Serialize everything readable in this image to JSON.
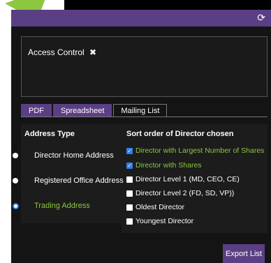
{
  "filter": {
    "chip_label": "Access Control",
    "chip_remove": "✖"
  },
  "tabs": [
    {
      "label": "PDF",
      "active": false
    },
    {
      "label": "Spreadsheet",
      "active": false
    },
    {
      "label": "Mailing List",
      "active": true
    }
  ],
  "address_type": {
    "header": "Address Type",
    "options": [
      {
        "label": "Director Home Address",
        "selected": false
      },
      {
        "label": "Registered Office Address",
        "selected": false
      },
      {
        "label": "Trading Address",
        "selected": true
      }
    ]
  },
  "sort_order": {
    "header": "Sort order of Director chosen",
    "options": [
      {
        "label": "Director with Largest Number of Shares",
        "checked": true
      },
      {
        "label": "Director with Shares",
        "checked": true
      },
      {
        "label": "Director Level 1 (MD, CEO, CE)",
        "checked": false
      },
      {
        "label": "Director Level 2 (FD, SD, VP))",
        "checked": false
      },
      {
        "label": "Oldest Director",
        "checked": false
      },
      {
        "label": "Youngest Director",
        "checked": false
      }
    ]
  },
  "actions": {
    "export_label": "Export List"
  },
  "icons": {
    "refresh": "refresh-icon",
    "checkmark": "✓"
  },
  "colors": {
    "accent_purple": "#5b3f84",
    "active_green": "#8dc63f",
    "check_blue": "#2f80ed",
    "panel_bg": "#141414"
  }
}
